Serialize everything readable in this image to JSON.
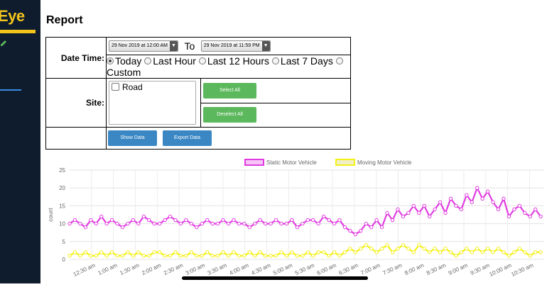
{
  "app": {
    "logo_text": "Eye"
  },
  "page": {
    "title": "Report"
  },
  "form": {
    "date_time_label": "Date Time:",
    "from_value": "29 Nov 2019 at 12:00 AM",
    "to_label": "To",
    "to_value": "29 Nov 2019 at 11:59 PM",
    "ranges": [
      {
        "label": "Today",
        "selected": true
      },
      {
        "label": "Last Hour",
        "selected": false
      },
      {
        "label": "Last 12 Hours",
        "selected": false
      },
      {
        "label": "Last 7 Days",
        "selected": false
      },
      {
        "label": "Custom",
        "selected": false
      }
    ],
    "site_label": "Site:",
    "sites": [
      {
        "label": "Road",
        "checked": false
      }
    ],
    "select_all_label": "Select All",
    "deselect_all_label": "Deselect All",
    "show_data_label": "Show Data",
    "export_data_label": "Export Data"
  },
  "colors": {
    "static": "#e13ce1",
    "moving": "#f4f018",
    "green_button": "#5cb85c",
    "blue_button": "#3a87c4"
  },
  "chart_data": {
    "type": "line",
    "title": "",
    "xlabel": "",
    "ylabel": "count",
    "ylim": [
      0,
      25
    ],
    "yticks": [
      0,
      5,
      10,
      15,
      20,
      25
    ],
    "grid": true,
    "legend_position": "top-center",
    "x_tick_labels": [
      "12:30 am",
      "1:00 am",
      "1:30 am",
      "2:00 am",
      "2:30 am",
      "3:00 am",
      "3:30 am",
      "4:00 am",
      "4:30 am",
      "5:00 am",
      "5:30 am",
      "6:00 am",
      "6:30 am",
      "7:00 am",
      "7:30 am",
      "8:00 am",
      "8:30 am",
      "9:00 am",
      "9:30 am",
      "10:00 am",
      "10:30 am"
    ],
    "x_start_minutes": 0,
    "x_end_minutes": 650,
    "series": [
      {
        "name": "Static Motor Vehicle",
        "color": "#e13ce1",
        "points_every_10min": [
          10,
          11,
          10,
          9,
          11,
          10,
          12,
          10,
          11,
          10,
          9,
          10,
          11,
          10,
          12,
          11,
          10,
          10,
          11,
          12,
          11,
          10,
          11,
          10,
          9,
          10,
          11,
          10,
          10,
          11,
          10,
          11,
          10,
          10,
          9,
          10,
          11,
          10,
          10,
          11,
          10,
          10,
          11,
          9,
          10,
          11,
          11,
          10,
          12,
          11,
          10,
          11,
          9,
          8,
          7,
          8,
          10,
          9,
          11,
          9,
          13,
          11,
          14,
          12,
          13,
          15,
          13,
          15,
          12,
          14,
          16,
          13,
          17,
          15,
          14,
          18,
          16,
          20,
          17,
          19,
          16,
          14,
          17,
          12,
          14,
          15,
          13,
          12,
          14,
          12
        ]
      },
      {
        "name": "Moving Motor Vehicle",
        "color": "#f4f018",
        "points_every_10min": [
          1,
          2,
          1,
          2,
          1,
          1,
          2,
          1,
          2,
          1,
          1,
          2,
          1,
          2,
          1,
          1,
          2,
          2,
          1,
          1,
          2,
          1,
          1,
          2,
          1,
          1,
          2,
          1,
          1,
          2,
          1,
          2,
          1,
          1,
          2,
          1,
          2,
          1,
          1,
          1,
          2,
          1,
          2,
          1,
          1,
          2,
          1,
          2,
          2,
          1,
          2,
          1,
          2,
          3,
          2,
          3,
          4,
          3,
          2,
          3,
          4,
          2,
          3,
          4,
          3,
          2,
          4,
          3,
          2,
          3,
          2,
          3,
          2,
          1,
          2,
          3,
          2,
          3,
          2,
          3,
          2,
          3,
          2,
          1,
          2,
          3,
          2,
          1,
          2,
          2
        ]
      }
    ]
  }
}
